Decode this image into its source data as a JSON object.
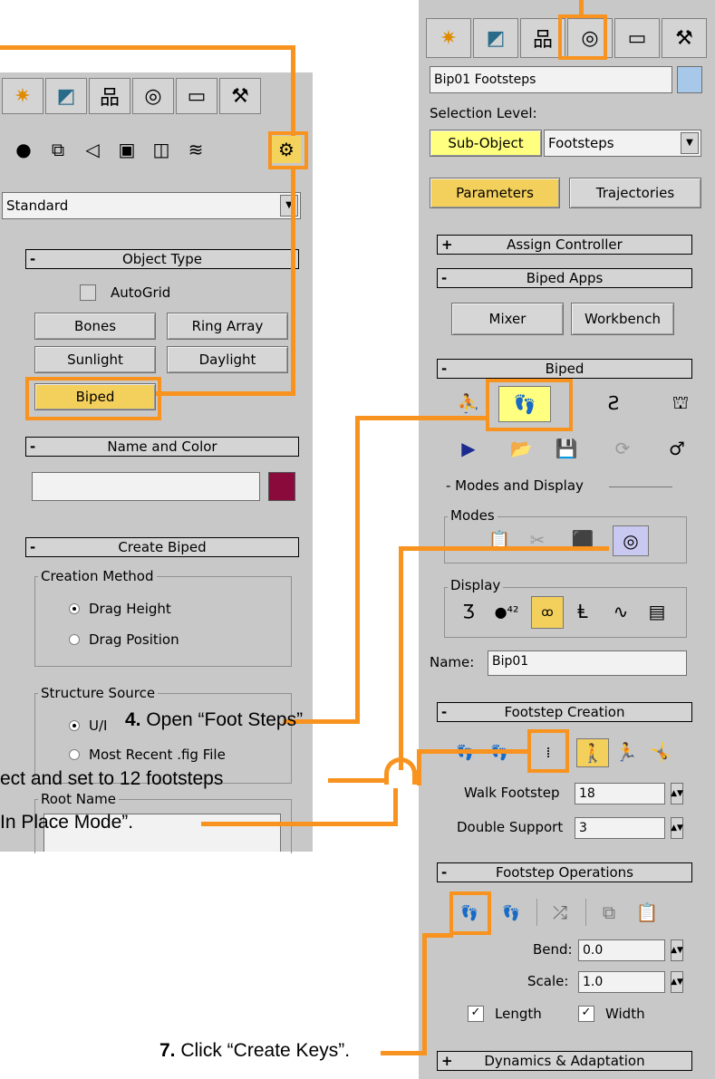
{
  "left_panel": {
    "dropdown_value": "Standard",
    "object_type": {
      "title": "Object Type",
      "autogrid": "AutoGrid",
      "buttons": [
        "Bones",
        "Ring Array",
        "Sunlight",
        "Daylight",
        "Biped"
      ]
    },
    "name_color": {
      "title": "Name and Color",
      "swatch_color": "#8b0a3c"
    },
    "create_biped": {
      "title": "Create Biped",
      "creation_method": "Creation Method",
      "drag_height": "Drag Height",
      "drag_position": "Drag Position",
      "structure_source": "Structure Source",
      "ui": "U/I",
      "most_recent": "Most Recent .fig File",
      "root_name": "Root Name"
    }
  },
  "right_panel": {
    "name_field": "Bip01 Footsteps",
    "selection_level": "Selection Level:",
    "sub_object": "Sub-Object",
    "sub_object_value": "Footsteps",
    "parameters": "Parameters",
    "trajectories": "Trajectories",
    "assign_controller": "Assign Controller",
    "biped_apps": "Biped Apps",
    "mixer": "Mixer",
    "workbench": "Workbench",
    "biped": "Biped",
    "modes_and_display": "- Modes and Display",
    "modes": "Modes",
    "display": "Display",
    "name_label": "Name:",
    "name_value": "Bip01",
    "footstep_creation": "Footstep Creation",
    "walk_footstep": "Walk Footstep",
    "walk_footstep_value": "18",
    "double_support": "Double Support",
    "double_support_value": "3",
    "footstep_operations": "Footstep Operations",
    "bend": "Bend:",
    "bend_value": "0.0",
    "scale": "Scale:",
    "scale_value": "1.0",
    "length": "Length",
    "width": "Width",
    "dynamics": "Dynamics & Adaptation"
  },
  "callouts": {
    "step4_num": "4.",
    "step4_text": " Open  “Foot Steps”",
    "step5_text": "ect  and set to 12  footsteps",
    "step6_text": "In Place Mode”.",
    "step7_num": "7.",
    "step7_text": " Click “Create Keys”."
  },
  "colors": {
    "accent": "#f7931e",
    "panel": "#c8c8c8",
    "swatch": "#8b0a3c",
    "highlight": "#f3cf5c"
  }
}
